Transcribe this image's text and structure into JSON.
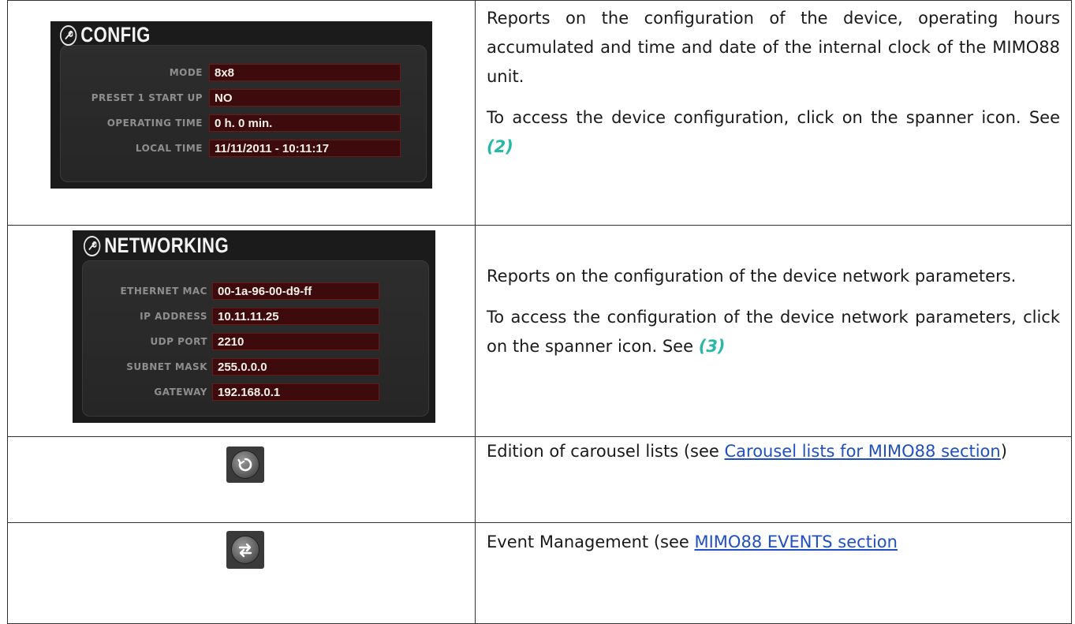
{
  "config_panel": {
    "title": "CONFIG",
    "fields": [
      {
        "label": "MODE",
        "value": "8x8"
      },
      {
        "label": "PRESET 1 START UP",
        "value": "NO"
      },
      {
        "label": "OPERATING TIME",
        "value": "0 h. 0 min."
      },
      {
        "label": "LOCAL TIME",
        "value": "11/11/2011 - 10:11:17"
      }
    ]
  },
  "networking_panel": {
    "title": "NETWORKING",
    "fields": [
      {
        "label": "ETHERNET MAC",
        "value": "00-1a-96-00-d9-ff"
      },
      {
        "label": "IP ADDRESS",
        "value": "10.11.11.25"
      },
      {
        "label": "UDP PORT",
        "value": "2210"
      },
      {
        "label": "SUBNET MASK",
        "value": "255.0.0.0"
      },
      {
        "label": "GATEWAY",
        "value": "192.168.0.1"
      }
    ]
  },
  "rows": {
    "config": {
      "p1": "Reports on the configuration of the device, operating hours accumulated and time and date of the internal clock of the MIMO88 unit.",
      "p2": "To access the device configuration, click on the spanner icon. See",
      "ref": "(2)"
    },
    "networking": {
      "p1": "Reports on the configuration of the device network parameters.",
      "p2": "To access the configuration of the device network parameters, click on the spanner icon. See",
      "ref": "(3)"
    },
    "carousel": {
      "pre": "Edition of carousel lists (see ",
      "link": "Carousel lists for MIMO88 section",
      "post": ")"
    },
    "events": {
      "pre": "Event Management (see ",
      "link": "MIMO88 EVENTS section",
      "post": ""
    }
  },
  "icons": {
    "config": "spanner-icon",
    "networking": "spanner-icon",
    "carousel": "refresh-icon",
    "events": "swap-arrows-icon"
  },
  "colors": {
    "reference": "#27b8a8",
    "link": "#1f4fc4",
    "field_bg": "#3d0b0b",
    "panel_bg": "#1b1b1b"
  }
}
